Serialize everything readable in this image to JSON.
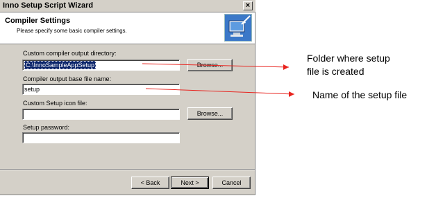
{
  "window": {
    "title": "Inno Setup Script Wizard",
    "close_glyph": "×"
  },
  "header": {
    "title": "Compiler Settings",
    "subtitle": "Please specify some basic compiler settings."
  },
  "fields": {
    "output_dir": {
      "label": "Custom compiler output directory:",
      "value": "C:\\InnoSampleAppSetup",
      "button": "Browse..."
    },
    "base_name": {
      "label": "Compiler output base file name:",
      "value": "setup"
    },
    "icon_file": {
      "label": "Custom Setup icon file:",
      "value": "",
      "button": "Browse..."
    },
    "password": {
      "label": "Setup password:",
      "value": ""
    }
  },
  "buttons": {
    "back": "< Back",
    "next": "Next >",
    "cancel": "Cancel"
  },
  "annotations": {
    "folder_line1": "Folder where setup",
    "folder_line2": "file is created",
    "name": "Name of the setup file"
  },
  "colors": {
    "arrow": "#e8231e",
    "selection": "#0a246a",
    "dialog": "#d4d0c8"
  }
}
